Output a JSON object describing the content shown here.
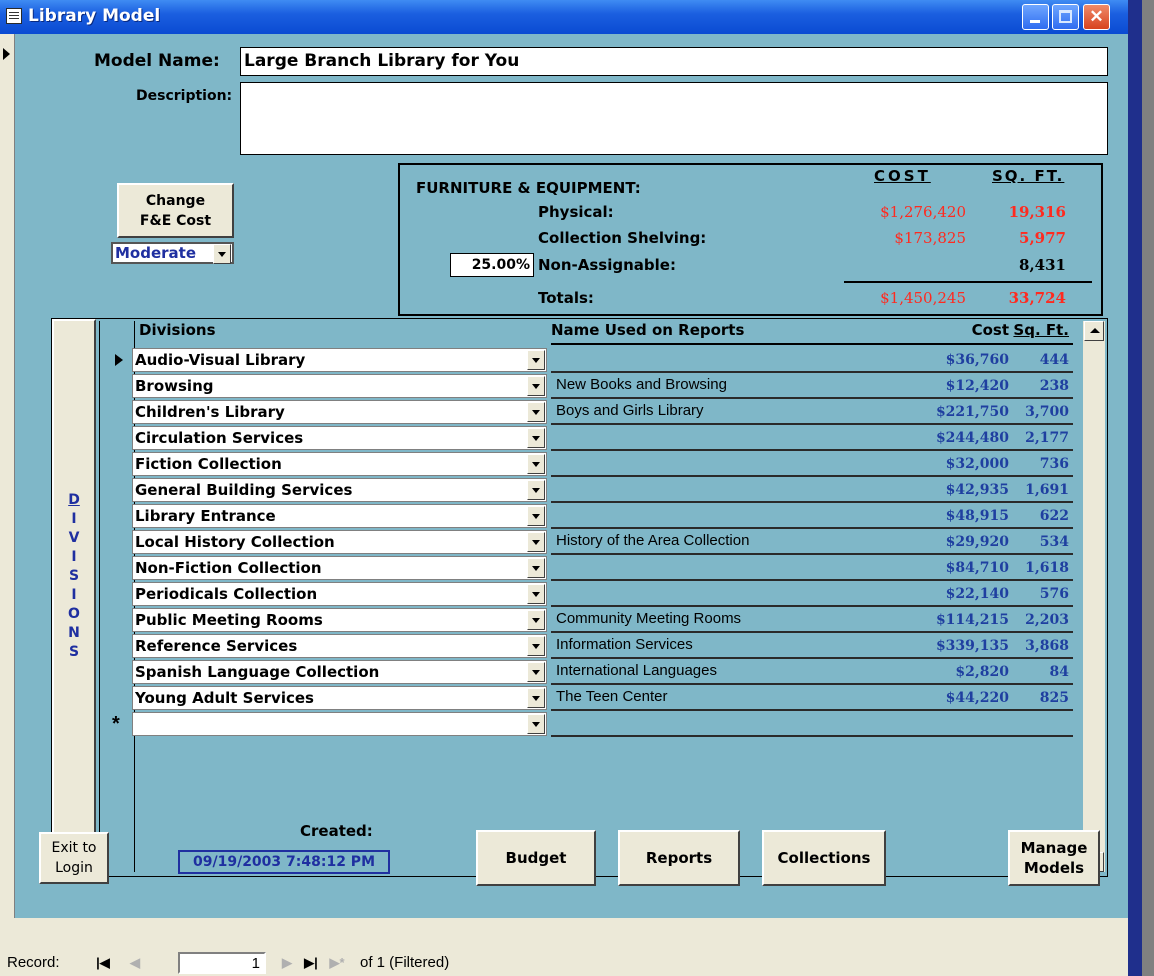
{
  "window": {
    "title": "Library Model"
  },
  "form": {
    "model_name_label": "Model Name:",
    "model_name_value": "Large Branch Library for You",
    "description_label": "Description:",
    "description_value": "",
    "change_fe_button": "Change\nF&E Cost",
    "fe_level": "Moderate"
  },
  "fe": {
    "heading": "FURNITURE & EQUIPMENT:",
    "cost_header": "COST",
    "sqft_header": "SQ. FT.",
    "physical_label": "Physical:",
    "physical_cost": "$1,276,420",
    "physical_sqft": "19,316",
    "shelving_label": "Collection Shelving:",
    "shelving_cost": "$173,825",
    "shelving_sqft": "5,977",
    "nonassign_pct": "25.00%",
    "nonassign_label": "Non-Assignable:",
    "nonassign_sqft": "8,431",
    "totals_label": "Totals:",
    "total_cost": "$1,450,245",
    "total_sqft": "33,724"
  },
  "divisions_tab": "DIVISIONS",
  "grid": {
    "headers": {
      "divisions": "Divisions",
      "report_name": "Name Used on Reports",
      "cost": "Cost",
      "sqft": "Sq. Ft."
    },
    "rows": [
      {
        "division": "Audio-Visual Library",
        "report_name": "",
        "cost": "$36,760",
        "sqft": "444"
      },
      {
        "division": "Browsing",
        "report_name": "New Books and Browsing",
        "cost": "$12,420",
        "sqft": "238"
      },
      {
        "division": "Children's Library",
        "report_name": "Boys and Girls Library",
        "cost": "$221,750",
        "sqft": "3,700"
      },
      {
        "division": "Circulation Services",
        "report_name": "",
        "cost": "$244,480",
        "sqft": "2,177"
      },
      {
        "division": "Fiction Collection",
        "report_name": "",
        "cost": "$32,000",
        "sqft": "736"
      },
      {
        "division": "General Building Services",
        "report_name": "",
        "cost": "$42,935",
        "sqft": "1,691"
      },
      {
        "division": "Library Entrance",
        "report_name": "",
        "cost": "$48,915",
        "sqft": "622"
      },
      {
        "division": "Local History Collection",
        "report_name": "History of the Area Collection",
        "cost": "$29,920",
        "sqft": "534"
      },
      {
        "division": "Non-Fiction Collection",
        "report_name": "",
        "cost": "$84,710",
        "sqft": "1,618"
      },
      {
        "division": "Periodicals Collection",
        "report_name": "",
        "cost": "$22,140",
        "sqft": "576"
      },
      {
        "division": "Public Meeting Rooms",
        "report_name": "Community Meeting Rooms",
        "cost": "$114,215",
        "sqft": "2,203"
      },
      {
        "division": "Reference Services",
        "report_name": "Information Services",
        "cost": "$339,135",
        "sqft": "3,868"
      },
      {
        "division": "Spanish Language Collection",
        "report_name": "International Languages",
        "cost": "$2,820",
        "sqft": "84"
      },
      {
        "division": "Young Adult Services",
        "report_name": "The Teen Center",
        "cost": "$44,220",
        "sqft": "825"
      }
    ],
    "new_row_marker": "*"
  },
  "footer": {
    "exit_button": "Exit to\nLogin",
    "created_label": "Created:",
    "created_value": "09/19/2003 7:48:12 PM",
    "budget_button": "Budget",
    "reports_button": "Reports",
    "collections_button": "Collections",
    "manage_button": "Manage\nModels"
  },
  "nav": {
    "record_label": "Record:",
    "current_record": "1",
    "of_text": "of  1 (Filtered)"
  }
}
